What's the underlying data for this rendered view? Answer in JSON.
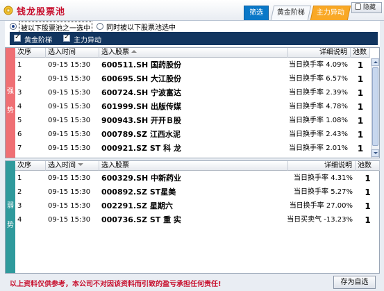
{
  "app": {
    "title": "钱龙股票池",
    "logo_icon": "coin-logo-icon"
  },
  "tabs": [
    {
      "label": "筛选",
      "active": true,
      "color": "#0a78c8"
    },
    {
      "label": "黄金阶梯",
      "active": false
    },
    {
      "label": "主力异动",
      "active": false,
      "color": "#f9a825"
    }
  ],
  "hide_button": {
    "label": "隐藏",
    "icon": "window-icon"
  },
  "filter": {
    "radio_any": {
      "label": "被以下股票池之一选中",
      "selected": true
    },
    "radio_all": {
      "label": "同时被以下股票池选中",
      "selected": false
    },
    "checks": [
      {
        "label": "黄金阶梯",
        "checked": true
      },
      {
        "label": "主力异动",
        "checked": true
      }
    ]
  },
  "columns": {
    "idx": "次序",
    "time": "选入时间",
    "stock": "选入股票",
    "desc": "详细说明",
    "count": "池数"
  },
  "strong": {
    "side_label": [
      "强",
      "势"
    ],
    "color": "#ef6f74",
    "rows": [
      {
        "idx": "1",
        "time": "09-15 15:30",
        "stock": "600511.SH 国药股份",
        "desc": "当日换手率 4.09%",
        "count": "1"
      },
      {
        "idx": "2",
        "time": "09-15 15:30",
        "stock": "600695.SH 大江股份",
        "desc": "当日换手率 6.57%",
        "count": "1"
      },
      {
        "idx": "3",
        "time": "09-15 15:30",
        "stock": "600724.SH 宁波富达",
        "desc": "当日换手率 2.39%",
        "count": "1"
      },
      {
        "idx": "4",
        "time": "09-15 15:30",
        "stock": "601999.SH 出版传媒",
        "desc": "当日换手率 4.78%",
        "count": "1"
      },
      {
        "idx": "5",
        "time": "09-15 15:30",
        "stock": "900943.SH 开开Ｂ股",
        "desc": "当日换手率 1.08%",
        "count": "1"
      },
      {
        "idx": "6",
        "time": "09-15 15:30",
        "stock": "000789.SZ 江西水泥",
        "desc": "当日换手率 2.43%",
        "count": "1"
      },
      {
        "idx": "7",
        "time": "09-15 15:30",
        "stock": "000921.SZ ST 科 龙",
        "desc": "当日换手率 2.01%",
        "count": "1"
      }
    ]
  },
  "weak": {
    "side_label": [
      "弱",
      "势"
    ],
    "color": "#2f9a9c",
    "rows": [
      {
        "idx": "1",
        "time": "09-15 15:30",
        "stock": "600329.SH 中新药业",
        "desc": "当日换手率 4.31%",
        "count": "1"
      },
      {
        "idx": "2",
        "time": "09-15 15:30",
        "stock": "000892.SZ ST星美",
        "desc": "当日换手率 5.27%",
        "count": "1"
      },
      {
        "idx": "3",
        "time": "09-15 15:30",
        "stock": "002291.SZ 星期六",
        "desc": "当日换手率 27.00%",
        "count": "1"
      },
      {
        "idx": "4",
        "time": "09-15 15:30",
        "stock": "000736.SZ ST 重 实",
        "desc": "当日买卖气 -13.23%",
        "count": "1"
      }
    ]
  },
  "footer": {
    "disclaimer": "以上资料仅供参考，本公司不对因该资料而引致的盈亏承担任何责任!",
    "save_label": "存为自选"
  }
}
